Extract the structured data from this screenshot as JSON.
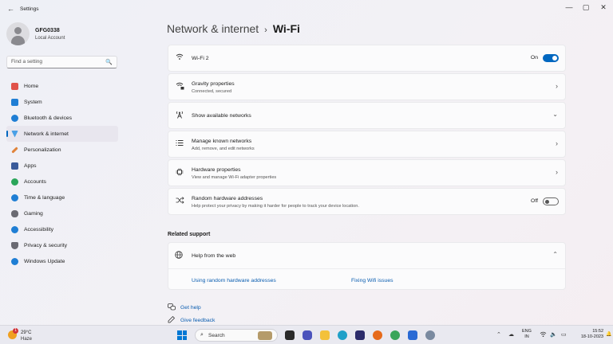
{
  "window": {
    "title": "Settings",
    "back_glyph": "←",
    "min_glyph": "—",
    "max_glyph": "▢",
    "close_glyph": "✕"
  },
  "profile": {
    "name": "GFG0338",
    "account_type": "Local Account"
  },
  "search": {
    "placeholder": "Find a setting",
    "icon": "🔍"
  },
  "sidebar": {
    "items": [
      {
        "label": "Home",
        "icon": "home-icon",
        "color": "#e0524a"
      },
      {
        "label": "System",
        "icon": "system-icon",
        "color": "#1f7ed4"
      },
      {
        "label": "Bluetooth & devices",
        "icon": "bluetooth-icon",
        "color": "#1f7ed4"
      },
      {
        "label": "Network & internet",
        "icon": "wifi-icon",
        "color": "#4aa0e6",
        "active": true
      },
      {
        "label": "Personalization",
        "icon": "brush-icon",
        "color": "#e0833a"
      },
      {
        "label": "Apps",
        "icon": "apps-icon",
        "color": "#3a5a9a"
      },
      {
        "label": "Accounts",
        "icon": "accounts-icon",
        "color": "#2aa55a"
      },
      {
        "label": "Time & language",
        "icon": "globe-icon",
        "color": "#1f7ed4"
      },
      {
        "label": "Gaming",
        "icon": "gaming-icon",
        "color": "#6a6a72"
      },
      {
        "label": "Accessibility",
        "icon": "accessibility-icon",
        "color": "#1f7ed4"
      },
      {
        "label": "Privacy & security",
        "icon": "shield-icon",
        "color": "#6a6a72"
      },
      {
        "label": "Windows Update",
        "icon": "update-icon",
        "color": "#1f7ed4"
      }
    ]
  },
  "breadcrumb": {
    "parent": "Network & internet",
    "separator": "›",
    "current": "Wi-Fi"
  },
  "cards": {
    "wifi": {
      "title": "Wi-Fi 2",
      "state": "On",
      "icon": "wifi-icon"
    },
    "gravity": {
      "title": "Gravity properties",
      "subtitle": "Connected, secured",
      "icon": "wifi-lock-icon"
    },
    "available": {
      "title": "Show available networks",
      "icon": "antenna-icon"
    },
    "known": {
      "title": "Manage known networks",
      "subtitle": "Add, remove, and edit networks",
      "icon": "list-icon"
    },
    "hardware": {
      "title": "Hardware properties",
      "subtitle": "View and manage Wi-Fi adapter properties",
      "icon": "chip-icon"
    },
    "random": {
      "title": "Random hardware addresses",
      "subtitle": "Help protect your privacy by making it harder for people to track your device location.",
      "state": "Off",
      "icon": "shuffle-icon"
    }
  },
  "related": {
    "heading": "Related support",
    "help_title": "Help from the web",
    "links": [
      "Using random hardware addresses",
      "Fixing Wifi issues"
    ]
  },
  "footer": {
    "get_help": "Get help",
    "feedback": "Give feedback"
  },
  "taskbar": {
    "weather_temp": "29°C",
    "weather_cond": "Haze",
    "weather_badge": "1",
    "search_label": "Search",
    "lang_top": "ENG",
    "lang_bottom": "IN",
    "time": "15:52",
    "date": "18-10-2023"
  }
}
